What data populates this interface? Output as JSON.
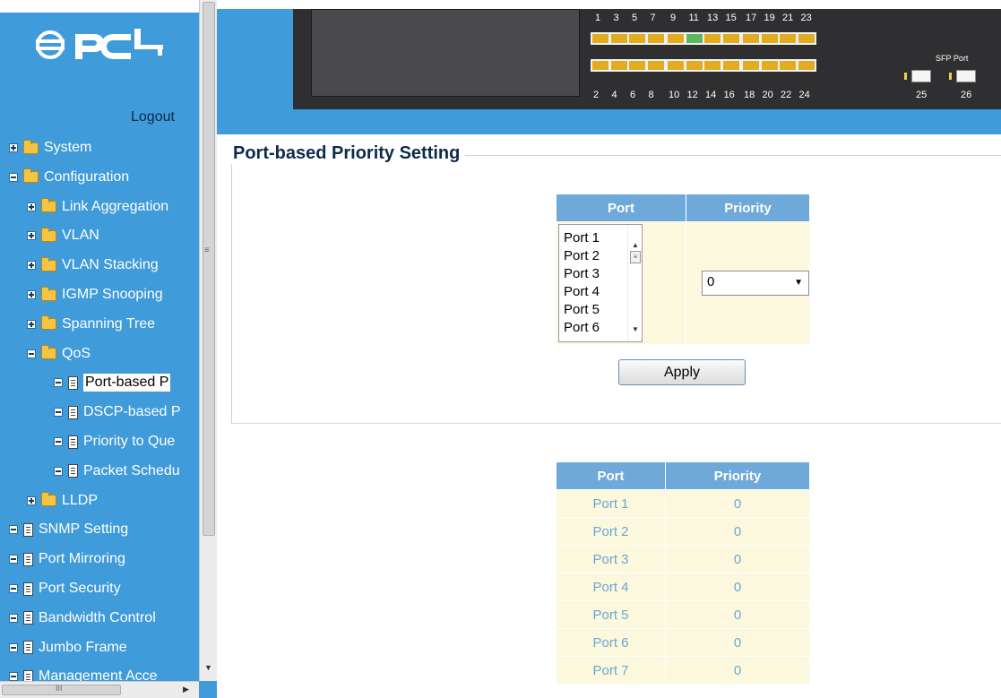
{
  "brand": {
    "logo_text": "PCi"
  },
  "sidebar": {
    "logout": "Logout",
    "tree": [
      {
        "label": "System",
        "type": "folder",
        "expander": "plus",
        "level": 0
      },
      {
        "label": "Configuration",
        "type": "folder",
        "expander": "minus",
        "level": 0
      },
      {
        "label": "Link Aggregation",
        "type": "folder",
        "expander": "plus",
        "level": 1
      },
      {
        "label": "VLAN",
        "type": "folder",
        "expander": "plus",
        "level": 1
      },
      {
        "label": "VLAN Stacking",
        "type": "folder",
        "expander": "plus",
        "level": 1
      },
      {
        "label": "IGMP Snooping",
        "type": "folder",
        "expander": "plus",
        "level": 1
      },
      {
        "label": "Spanning Tree",
        "type": "folder",
        "expander": "plus",
        "level": 1
      },
      {
        "label": "QoS",
        "type": "folder",
        "expander": "minus",
        "level": 1
      },
      {
        "label": "Port-based P",
        "type": "doc",
        "expander": "minus",
        "level": 2,
        "selected": true
      },
      {
        "label": "DSCP-based P",
        "type": "doc",
        "expander": "minus",
        "level": 2
      },
      {
        "label": "Priority to Que",
        "type": "doc",
        "expander": "minus",
        "level": 2
      },
      {
        "label": "Packet Schedu",
        "type": "doc",
        "expander": "minus",
        "level": 2
      },
      {
        "label": "LLDP",
        "type": "folder",
        "expander": "plus",
        "level": 1
      },
      {
        "label": "SNMP Setting",
        "type": "doc",
        "expander": "minus",
        "level": 0
      },
      {
        "label": "Port Mirroring",
        "type": "doc",
        "expander": "minus",
        "level": 0
      },
      {
        "label": "Port Security",
        "type": "doc",
        "expander": "minus",
        "level": 0
      },
      {
        "label": "Bandwidth Control",
        "type": "doc",
        "expander": "minus",
        "level": 0
      },
      {
        "label": "Jumbo Frame",
        "type": "doc",
        "expander": "minus",
        "level": 0
      },
      {
        "label": "Management Acce",
        "type": "doc",
        "expander": "minus",
        "level": 0
      }
    ]
  },
  "device": {
    "top_port_numbers": [
      "1",
      "3",
      "5",
      "7",
      "9",
      "11",
      "13",
      "15",
      "17",
      "19",
      "21",
      "23"
    ],
    "bottom_port_numbers": [
      "2",
      "4",
      "6",
      "8",
      "10",
      "12",
      "14",
      "16",
      "18",
      "20",
      "22",
      "24"
    ],
    "sfp_label": "SFP Port",
    "sfp_port_numbers": [
      "25",
      "26"
    ],
    "link_up_ports": [
      "11"
    ]
  },
  "page": {
    "title": "Port-based Priority Setting"
  },
  "edit_form": {
    "headers": [
      "Port",
      "Priority"
    ],
    "port_options": [
      "Port 1",
      "Port 2",
      "Port 3",
      "Port 4",
      "Port 5",
      "Port 6"
    ],
    "priority_value": "0",
    "apply_label": "Apply"
  },
  "priority_table": {
    "headers": [
      "Port",
      "Priority"
    ],
    "rows": [
      {
        "port": "Port 1",
        "priority": "0"
      },
      {
        "port": "Port 2",
        "priority": "0"
      },
      {
        "port": "Port 3",
        "priority": "0"
      },
      {
        "port": "Port 4",
        "priority": "0"
      },
      {
        "port": "Port 5",
        "priority": "0"
      },
      {
        "port": "Port 6",
        "priority": "0"
      },
      {
        "port": "Port 7",
        "priority": "0"
      }
    ]
  },
  "colors": {
    "sidebar_bg": "#3f9bd9",
    "table_header": "#6fa9d9",
    "table_cell": "#fbf8dd",
    "link_text": "#6aa7d4",
    "title": "#0d2a4a",
    "port_amber": "#e3ab1f",
    "port_link_up": "#5cb85c"
  }
}
